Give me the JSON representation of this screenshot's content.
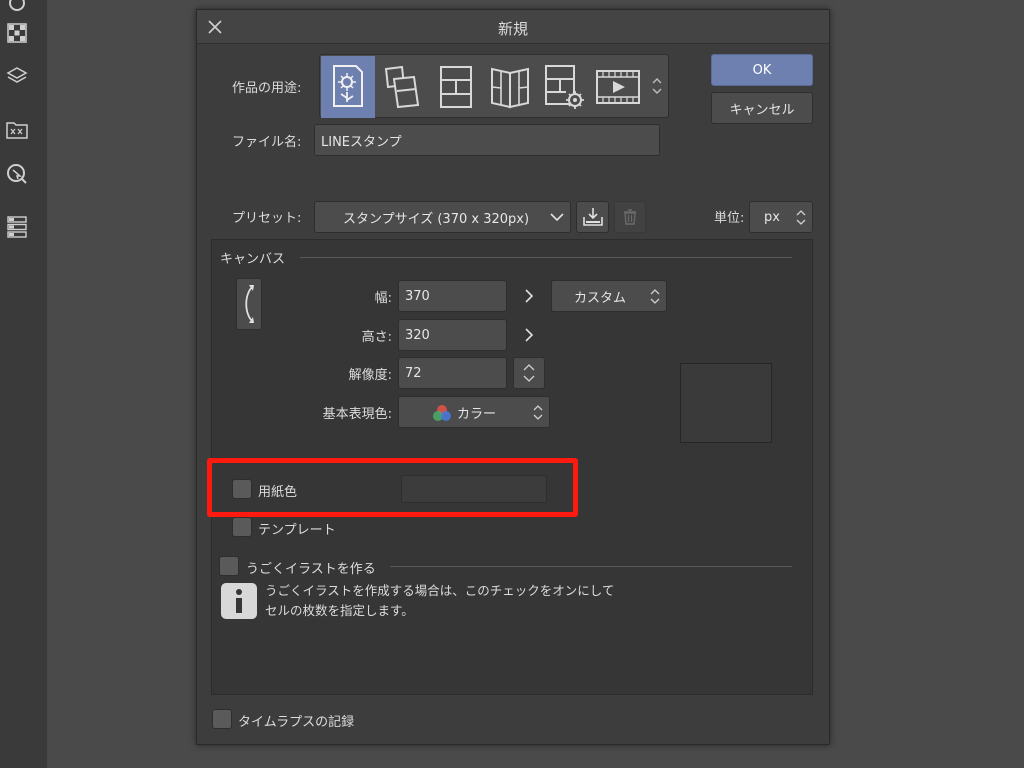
{
  "dialog": {
    "title": "新規",
    "ok_label": "OK",
    "cancel_label": "キャンセル"
  },
  "usage": {
    "label": "作品の用途:",
    "options": [
      {
        "icon": "illustration-icon",
        "selected": true
      },
      {
        "icon": "comic-icon",
        "selected": false
      },
      {
        "icon": "comic-page-icon",
        "selected": false
      },
      {
        "icon": "book-spread-icon",
        "selected": false
      },
      {
        "icon": "comic-settings-icon",
        "selected": false
      },
      {
        "icon": "animation-icon",
        "selected": false
      }
    ]
  },
  "filename": {
    "label": "ファイル名:",
    "value": "LINEスタンプ"
  },
  "preset": {
    "label": "プリセット:",
    "value": "スタンプサイズ (370 x 320px)"
  },
  "unit": {
    "label": "単位:",
    "value": "px"
  },
  "canvas": {
    "section_title": "キャンバス",
    "width_label": "幅:",
    "width_value": "370",
    "height_label": "高さ:",
    "height_value": "320",
    "size_preset_value": "カスタム",
    "resolution_label": "解像度:",
    "resolution_value": "72",
    "color_label": "基本表現色:",
    "color_value": "カラー"
  },
  "paper_color": {
    "label": "用紙色",
    "checked": false
  },
  "template": {
    "label": "テンプレート",
    "checked": false
  },
  "animated_illustration": {
    "label": "うごくイラストを作る",
    "info_line1": "うごくイラストを作成する場合は、このチェックをオンにして",
    "info_line2": "セルの枚数を指定します。"
  },
  "timelapse": {
    "label": "タイムラプスの記録"
  },
  "colors": {
    "accent": "#6e80b0",
    "highlight": "#ff1a10",
    "dialog_bg": "#3d3d3d",
    "panel_bg": "#363636"
  }
}
